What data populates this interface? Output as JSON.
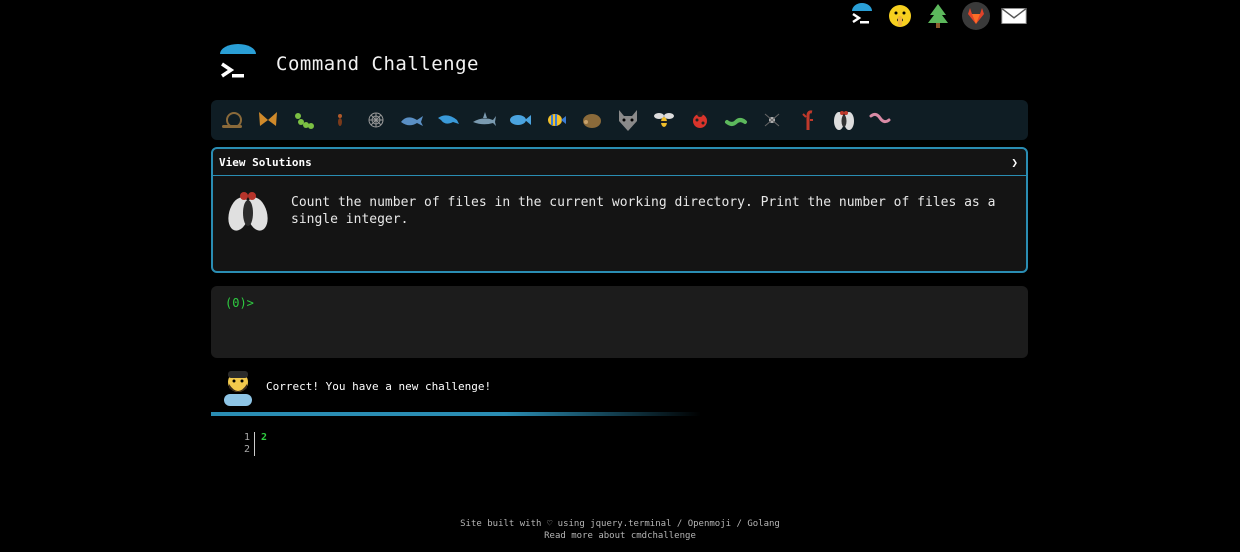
{
  "top_icons": [
    "terminal-icon",
    "shushing-face-icon",
    "tree-icon",
    "gitlab-icon",
    "envelope-icon"
  ],
  "header": {
    "title": "Command Challenge",
    "logo": "terminal-logo-icon"
  },
  "challenge_strip": [
    "snail-icon",
    "butterfly-icon",
    "caterpillar-icon",
    "ant-icon",
    "spider-web-icon",
    "whale-icon",
    "dolphin-icon",
    "shark-icon",
    "fish-icon",
    "tropical-fish-icon",
    "hedgehog-icon",
    "wolf-icon",
    "bee-icon",
    "ladybug-icon",
    "worm-icon",
    "spider-icon",
    "scorpion-icon",
    "fly-icon",
    "earthworm-icon"
  ],
  "card": {
    "header_label": "View Solutions",
    "chevron": "❯",
    "text_line1": "Count the number of files in the current working directory. Print the number of files as a",
    "text_line2": "single integer."
  },
  "terminal": {
    "prompt": "(0)>"
  },
  "feedback": {
    "message": "Correct! You have a new challenge!"
  },
  "output": {
    "line_numbers": [
      "1",
      "2"
    ],
    "lines": [
      "2",
      ""
    ]
  },
  "footer": {
    "line1": "Site built with ♡ using jquery.terminal / Openmoji / Golang",
    "line2": "Read more about cmdchallenge"
  },
  "colors": {
    "accent": "#2a8db3",
    "prompt": "#2ecc40",
    "background": "#000000"
  }
}
